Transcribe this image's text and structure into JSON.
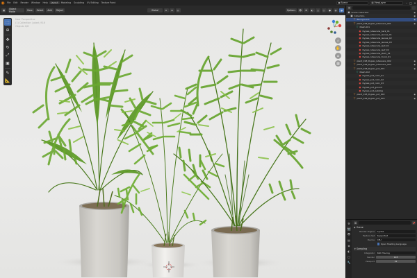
{
  "topbar": {
    "menu": [
      "File",
      "Edit",
      "Render",
      "Window",
      "Help",
      "Layout",
      "Modeling",
      "Sculpting",
      "UV Editing",
      "Texture Paint"
    ],
    "scene": "Scene",
    "view_layer": "ViewLayer"
  },
  "viewport_header": {
    "mode": "Object Mode",
    "view": "View",
    "select": "Select",
    "add": "Add",
    "object": "Object",
    "transform": "Global",
    "options": "Options"
  },
  "viewport": {
    "info_lines": [
      "User Perspective",
      "(1) Collection | plant_918",
      "Objects 0/8"
    ]
  },
  "outliner": {
    "title": "Scene Collection",
    "rows": [
      {
        "label": "Scene Collection",
        "indent": 0,
        "icon": "collection"
      },
      {
        "label": "Collection",
        "indent": 1,
        "icon": "collection"
      },
      {
        "label": "Background",
        "indent": 2,
        "icon": "object",
        "selected": true
      },
      {
        "label": "plant_918_Dypsis_lutescens_001",
        "indent": 2,
        "icon": "object"
      },
      {
        "label": "Mesh.001",
        "indent": 3,
        "icon": "mesh"
      },
      {
        "label": "Dypsis_lutescens_bark_01",
        "indent": 4,
        "icon": "material"
      },
      {
        "label": "Dypsis_lutescens_leaves_01",
        "indent": 4,
        "icon": "material"
      },
      {
        "label": "Dypsis_lutescens_leaves_02",
        "indent": 4,
        "icon": "material"
      },
      {
        "label": "Dypsis_lutescens_leaves_03",
        "indent": 4,
        "icon": "material"
      },
      {
        "label": "Dypsis_lutescens_leaf_01",
        "indent": 4,
        "icon": "material"
      },
      {
        "label": "Dypsis_lutescens_leaf_02",
        "indent": 4,
        "icon": "material"
      },
      {
        "label": "Dypsis_lutescens_stem_01",
        "indent": 4,
        "icon": "material"
      },
      {
        "label": "Dypsis_lutescens_trunk_01",
        "indent": 4,
        "icon": "material"
      },
      {
        "label": "plant_918_Dypsis_lutescens_002",
        "indent": 2,
        "icon": "object"
      },
      {
        "label": "plant_918_Dypsis_lutescens_003",
        "indent": 2,
        "icon": "object"
      },
      {
        "label": "plant_918_Dypsis_pot_001",
        "indent": 2,
        "icon": "object"
      },
      {
        "label": "Mesh.002",
        "indent": 3,
        "icon": "mesh"
      },
      {
        "label": "Dypsis_pot_color_01",
        "indent": 4,
        "icon": "material"
      },
      {
        "label": "Dypsis_pot_color_02",
        "indent": 4,
        "icon": "material"
      },
      {
        "label": "Dypsis_pot_color_03",
        "indent": 4,
        "icon": "material"
      },
      {
        "label": "Dypsis_pot_ground",
        "indent": 4,
        "icon": "material"
      },
      {
        "label": "Dypsis_pot_pebbles",
        "indent": 4,
        "icon": "material"
      },
      {
        "label": "plant_918_Dypsis_pot_002",
        "indent": 2,
        "icon": "object"
      },
      {
        "label": "plant_918_Dypsis_pot_003",
        "indent": 2,
        "icon": "object"
      }
    ]
  },
  "properties": {
    "section_title": "Scene",
    "render_engine_label": "Render Engine",
    "render_engine": "Cycles",
    "feature_set_label": "Feature Set",
    "feature_set": "Supported",
    "device_label": "Device",
    "device": "CPU",
    "osl_label": "Open Shading Language",
    "sampling_label": "Sampling",
    "integrator_label": "Integrator",
    "integrator": "Path Tracing",
    "render_label": "Render",
    "render_samples": "128",
    "viewport_label": "Viewport",
    "viewport_samples": "32"
  },
  "colors": {
    "accent": "#4772b3",
    "blender_orange": "#e87d0d",
    "axis_x": "#d9463f",
    "axis_y": "#70b230",
    "axis_z": "#3d7fd6"
  }
}
